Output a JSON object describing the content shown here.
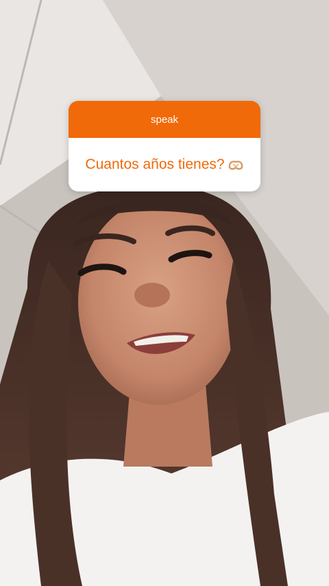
{
  "question_sticker": {
    "prompt": "speak",
    "question": "Cuantos años tienes?",
    "emoji_icon": "heart-hands-icon",
    "accent_color": "#f06a0a",
    "body_color": "#ffffff"
  }
}
